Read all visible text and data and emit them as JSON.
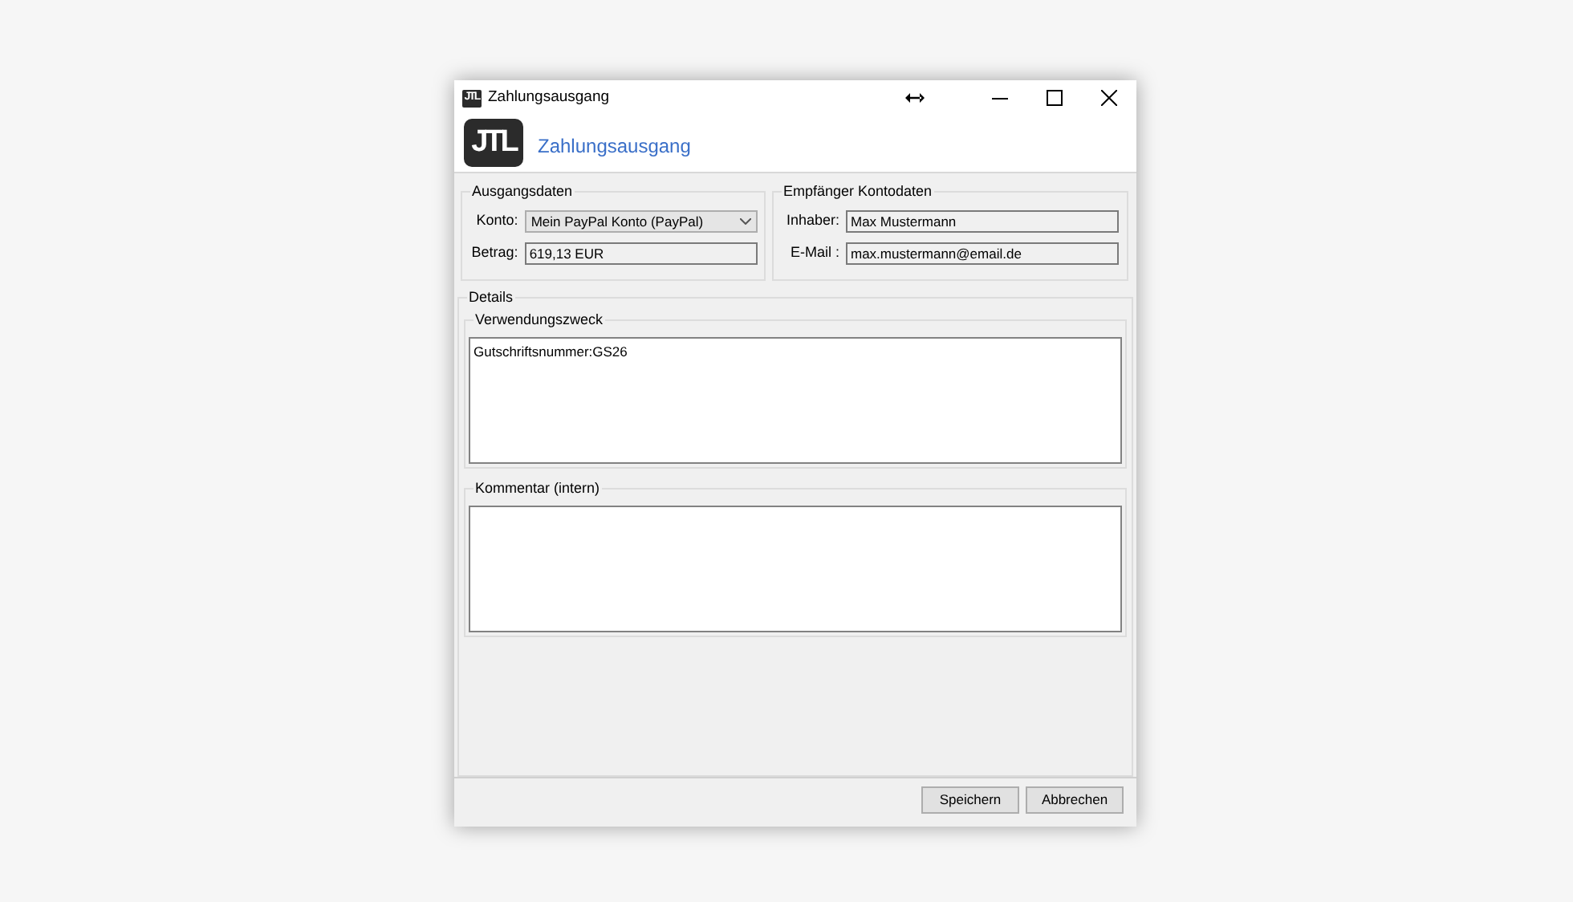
{
  "window": {
    "icon": "JTL",
    "title": "Zahlungsausgang"
  },
  "header": {
    "logo": "JTL",
    "title": "Zahlungsausgang"
  },
  "ausgangsdaten": {
    "title": "Ausgangsdaten",
    "fields": [
      {
        "label": "Konto:",
        "kind": "dropdown",
        "value": "Mein PayPal Konto (PayPal)"
      },
      {
        "label": "Betrag:",
        "kind": "text",
        "value": "619,13 EUR"
      }
    ]
  },
  "empfaenger": {
    "title": "Empfänger Kontodaten",
    "fields": [
      {
        "label": "Inhaber:",
        "kind": "text",
        "value": "Max Mustermann"
      },
      {
        "label": "E-Mail :",
        "kind": "text",
        "value": "max.mustermann@email.de"
      }
    ]
  },
  "details": {
    "title": "Details",
    "sections": [
      {
        "title": "Verwendungszweck",
        "value": "Gutschriftsnummer:GS26"
      },
      {
        "title": "Kommentar (intern)"
      }
    ]
  },
  "buttons": [
    "Speichern",
    "Abbrechen"
  ]
}
